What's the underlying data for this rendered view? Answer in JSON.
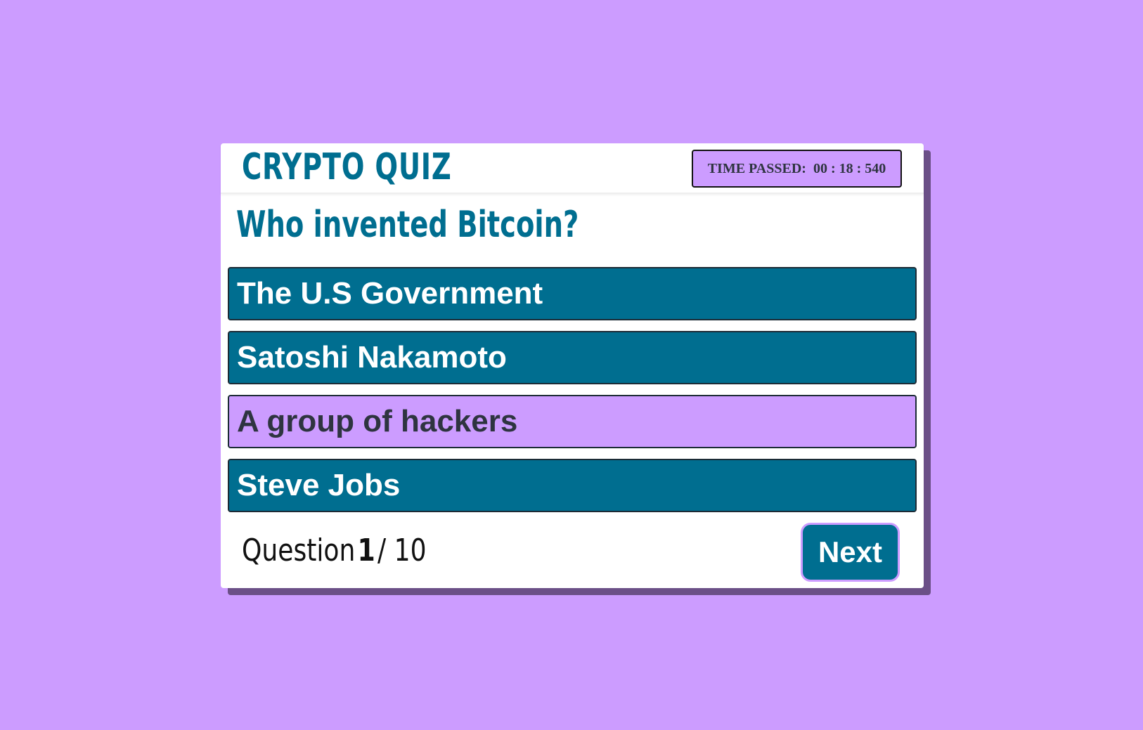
{
  "header": {
    "title": "CRYPTO QUIZ",
    "timer": {
      "label": "TIME PASSED:",
      "minutes": "00",
      "seconds": "18",
      "milliseconds": "540"
    }
  },
  "question": {
    "text": "Who invented Bitcoin?",
    "options": [
      {
        "label": "The U.S Government"
      },
      {
        "label": "Satoshi Nakamoto"
      },
      {
        "label": "A group of hackers"
      },
      {
        "label": "Steve Jobs"
      }
    ]
  },
  "footer": {
    "counter_label": "Question",
    "current": "1",
    "separator": "/",
    "total": "10",
    "next_label": "Next"
  },
  "colors": {
    "background": "#cc9cff",
    "accent": "#006e90",
    "card": "#ffffff",
    "shadow": "#6b4f87"
  }
}
